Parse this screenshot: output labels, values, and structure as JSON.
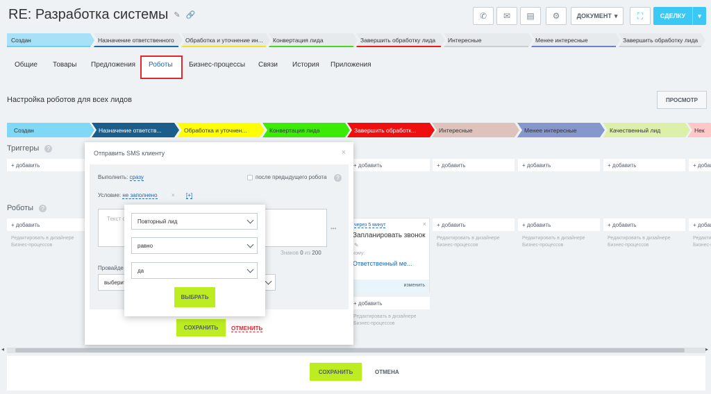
{
  "header": {
    "title": "RE: Разработка системы",
    "doc_label": "ДОКУМЕНТ",
    "deal_label": "СДЕЛКУ"
  },
  "top_stages": [
    {
      "label": "Создан",
      "color": "#6dd0f3"
    },
    {
      "label": "Назначение ответственного",
      "color": "#1b68a3"
    },
    {
      "label": "Обработка и уточнение ин...",
      "color": "#f3e31f"
    },
    {
      "label": "Конвертация лида",
      "color": "#47d51e"
    },
    {
      "label": "Завершить обработку лида",
      "color": "#f01919"
    },
    {
      "label": "Интересные",
      "color": "#c9ccd0"
    },
    {
      "label": "Менее интересные",
      "color": "#6d82c6"
    },
    {
      "label": "Завершить обработку лида",
      "color": "#c9ccd0"
    }
  ],
  "tabs": [
    "Общие",
    "Товары",
    "Предложения",
    "Роботы",
    "Бизнес-процессы",
    "Связи",
    "История",
    "Приложения"
  ],
  "section": {
    "title": "Настройка роботов для всех лидов",
    "preview_label": "ПРОСМОТР"
  },
  "stages": [
    {
      "label": "Создан",
      "bg": "#7fd8f6",
      "fg": "#333"
    },
    {
      "label": "Назначение ответств...",
      "bg": "#1b5e8c",
      "fg": "#fff"
    },
    {
      "label": "Обработка и уточнен...",
      "bg": "#ffff00",
      "fg": "#333"
    },
    {
      "label": "Конвертация лида",
      "bg": "#3ceb05",
      "fg": "#333"
    },
    {
      "label": "Завершить обработк...",
      "bg": "#f00f0f",
      "fg": "#fff"
    },
    {
      "label": "Интересные",
      "bg": "#dfc2bc",
      "fg": "#333"
    },
    {
      "label": "Менее интересные",
      "bg": "#8597cc",
      "fg": "#333"
    },
    {
      "label": "Качественный лид",
      "bg": "#dcf0a9",
      "fg": "#333"
    },
    {
      "label": "Нек",
      "bg": "#ffc7c7",
      "fg": "#333"
    }
  ],
  "triggers": {
    "title": "Триггеры",
    "add": "+ добавить"
  },
  "robots": {
    "title": "Роботы",
    "add": "+ добавить",
    "hint_line1": "Редактировать в дизайнере",
    "hint_line2": "Бизнес-процессов"
  },
  "robot_card": {
    "delay": "через 5 минут",
    "title": "Запланировать звонок",
    "who_label": "кому:",
    "who_value": "Ответственный ме...",
    "edit": "изменить"
  },
  "footer": {
    "save": "СОХРАНИТЬ",
    "cancel": "ОТМЕНА"
  },
  "popup": {
    "title": "Отправить SMS клиенту",
    "execute_label": "Выполнить:",
    "execute_value": "сразу",
    "after_prev": "после предыдущего робота",
    "condition_label": "Условие:",
    "condition_value": "не заполнено",
    "condition_add": "[+]",
    "text_placeholder": "Текст с",
    "chars_label": "Знаков",
    "chars_count": "0",
    "chars_of": "из",
    "chars_max": "200",
    "provider_label": "Провайде",
    "provider_value": "выберит",
    "save": "СОХРАНИТЬ",
    "cancel": "ОТМЕНИТЬ"
  },
  "dropdown": {
    "field": "Повторный лид",
    "operator": "равно",
    "value": "да",
    "choose": "ВЫБРАТЬ"
  }
}
